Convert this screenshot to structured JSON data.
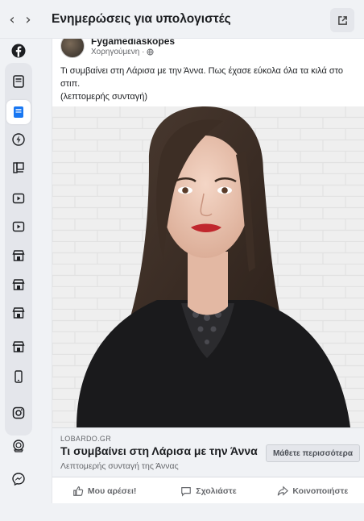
{
  "header": {
    "title": "Ενημερώσεις για υπολογιστές",
    "back_icon": "chevron-left-icon",
    "forward_icon": "chevron-right-icon",
    "popout_icon": "external-link-icon"
  },
  "sidebar": {
    "items": [
      {
        "icon": "facebook-icon",
        "active": false
      },
      {
        "icon": "news-icon",
        "active": false
      },
      {
        "icon": "news-icon",
        "active": true
      },
      {
        "icon": "lightning-icon",
        "active": false
      },
      {
        "icon": "news-icon",
        "active": false
      },
      {
        "icon": "video-icon",
        "active": false
      },
      {
        "icon": "video-icon",
        "active": false
      },
      {
        "icon": "store-icon",
        "active": false
      },
      {
        "icon": "store-icon",
        "active": false
      },
      {
        "icon": "store-icon",
        "active": false
      },
      {
        "icon": "store-icon",
        "active": false
      },
      {
        "icon": "phone-icon",
        "active": false
      },
      {
        "icon": "instagram-icon",
        "active": false
      },
      {
        "icon": "oculus-icon",
        "active": false
      },
      {
        "icon": "messenger-icon",
        "active": false
      }
    ]
  },
  "post": {
    "page_name": "Fygamediaskopes",
    "sponsored": "Χορηγούμενη ·",
    "text_line1": "Τι συμβαίνει στη Λάρισα με την Άννα. Πως έχασε εύκολα όλα τα κιλά στο στιπ.",
    "text_line2": "(λεπτομερής συνταγή)",
    "link": {
      "domain": "LOBARDO.GR",
      "title": "Τι συμβαίνει στη Λάρισα με την Άννα",
      "description": "Λεπτομερής συνταγή της Άννας",
      "cta": "Μάθετε περισσότερα"
    },
    "actions": {
      "like": "Μου αρέσει!",
      "comment": "Σχολιάστε",
      "share": "Κοινοποιήστε"
    }
  },
  "colors": {
    "brand": "#1877f2",
    "background": "#f0f2f5",
    "lips": "#c0272d"
  }
}
